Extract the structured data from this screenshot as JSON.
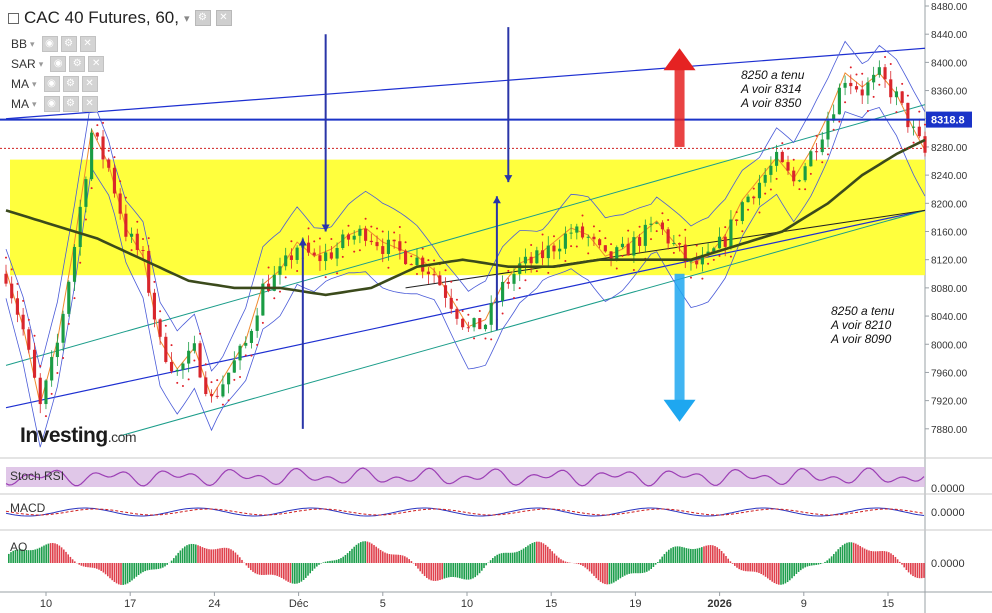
{
  "header": {
    "title": "CAC 40 Futures, 60,",
    "overlays": [
      {
        "name": "BB"
      },
      {
        "name": "SAR"
      },
      {
        "name": "MA"
      },
      {
        "name": "MA"
      }
    ]
  },
  "logo": {
    "name": "Investing",
    "suffix": ".com"
  },
  "notes": {
    "upper": [
      "8250 a tenu",
      "A voir 8314",
      "A voir 8350"
    ],
    "lower": [
      "8250 a tenu",
      "A voir 8210",
      "A voir 8090"
    ]
  },
  "subpanels": [
    {
      "label": "Stoch RSI",
      "value": "0.0000"
    },
    {
      "label": "MACD",
      "value": "0.0000"
    },
    {
      "label": "AO",
      "value": "0.0000"
    }
  ],
  "colors": {
    "zone": "#ffff33",
    "channel": "#1d2fd1",
    "ma_long": "#3b4a1b",
    "up_arrow": "#e52222",
    "down_arrow": "#1ea7f0",
    "price_label_bg": "#1a33c8",
    "rsi_line": "#9c3fb5",
    "ao_up": "#1e9e4c",
    "ao_down": "#e0414d"
  },
  "chart_data": {
    "type": "candlestick",
    "instrument": "CAC 40 Futures",
    "timeframe": "60",
    "ylim": [
      7840,
      8480
    ],
    "y_ticks": [
      8480,
      8440,
      8400,
      8360,
      8320,
      8280,
      8240,
      8200,
      8160,
      8120,
      8080,
      8040,
      8000,
      7960,
      7920,
      7880
    ],
    "x_ticks": [
      "10",
      "17",
      "24",
      "Déc",
      "5",
      "10",
      "15",
      "19",
      "2026",
      "9",
      "15"
    ],
    "last_price": "8318.8",
    "support_zone": [
      8098,
      8262
    ],
    "horizontal_line": 8318.8,
    "price_path": [
      [
        0,
        8100
      ],
      [
        3,
        8020
      ],
      [
        6,
        7910
      ],
      [
        9,
        8000
      ],
      [
        12,
        8140
      ],
      [
        15,
        8300
      ],
      [
        18,
        8250
      ],
      [
        21,
        8160
      ],
      [
        24,
        8120
      ],
      [
        27,
        8000
      ],
      [
        30,
        7960
      ],
      [
        33,
        7990
      ],
      [
        36,
        7920
      ],
      [
        39,
        7960
      ],
      [
        42,
        8000
      ],
      [
        45,
        8080
      ],
      [
        48,
        8100
      ],
      [
        51,
        8140
      ],
      [
        54,
        8120
      ],
      [
        57,
        8130
      ],
      [
        60,
        8150
      ],
      [
        63,
        8160
      ],
      [
        66,
        8140
      ],
      [
        69,
        8130
      ],
      [
        72,
        8120
      ],
      [
        75,
        8100
      ],
      [
        78,
        8060
      ],
      [
        81,
        8020
      ],
      [
        84,
        8030
      ],
      [
        87,
        8080
      ],
      [
        90,
        8110
      ],
      [
        93,
        8120
      ],
      [
        96,
        8140
      ],
      [
        99,
        8160
      ],
      [
        102,
        8150
      ],
      [
        105,
        8120
      ],
      [
        108,
        8130
      ],
      [
        111,
        8150
      ],
      [
        114,
        8170
      ],
      [
        117,
        8140
      ],
      [
        120,
        8110
      ],
      [
        123,
        8120
      ],
      [
        126,
        8150
      ],
      [
        129,
        8200
      ],
      [
        132,
        8230
      ],
      [
        135,
        8260
      ],
      [
        138,
        8230
      ],
      [
        141,
        8270
      ],
      [
        144,
        8320
      ],
      [
        147,
        8380
      ],
      [
        150,
        8360
      ],
      [
        153,
        8380
      ],
      [
        156,
        8350
      ],
      [
        159,
        8300
      ],
      [
        161,
        8270
      ]
    ],
    "ma_long": [
      [
        0,
        8190
      ],
      [
        8,
        8170
      ],
      [
        16,
        8150
      ],
      [
        24,
        8120
      ],
      [
        32,
        8090
      ],
      [
        40,
        8080
      ],
      [
        48,
        8080
      ],
      [
        56,
        8070
      ],
      [
        64,
        8080
      ],
      [
        72,
        8110
      ],
      [
        80,
        8120
      ],
      [
        88,
        8110
      ],
      [
        96,
        8110
      ],
      [
        104,
        8120
      ],
      [
        112,
        8120
      ],
      [
        120,
        8120
      ],
      [
        128,
        8140
      ],
      [
        136,
        8160
      ],
      [
        144,
        8200
      ],
      [
        150,
        8240
      ],
      [
        156,
        8270
      ],
      [
        161,
        8290
      ]
    ],
    "trend_lines": [
      {
        "name": "upper channel",
        "from": [
          0,
          8320
        ],
        "to": [
          161,
          8420
        ]
      },
      {
        "name": "lower channel",
        "from": [
          0,
          7910
        ],
        "to": [
          161,
          8190
        ]
      },
      {
        "name": "mid channel",
        "from": [
          0,
          7970
        ],
        "to": [
          161,
          8340
        ]
      },
      {
        "name": "support",
        "from": [
          20,
          7870
        ],
        "to": [
          161,
          8190
        ]
      },
      {
        "name": "uptrend",
        "from": [
          70,
          8080
        ],
        "to": [
          161,
          8190
        ]
      }
    ],
    "annotation_arrows": [
      {
        "dir": "down",
        "color": "blue",
        "from": [
          56,
          8440
        ],
        "to": [
          56,
          8160
        ]
      },
      {
        "dir": "up",
        "color": "blue",
        "from": [
          52,
          7880
        ],
        "to": [
          52,
          8150
        ]
      },
      {
        "dir": "down",
        "color": "blue",
        "from": [
          88,
          8450
        ],
        "to": [
          88,
          8230
        ]
      },
      {
        "dir": "up",
        "color": "blue",
        "from": [
          86,
          8020
        ],
        "to": [
          86,
          8210
        ]
      },
      {
        "dir": "up",
        "color": "red",
        "from": [
          118,
          8280
        ],
        "to": [
          118,
          8420
        ]
      },
      {
        "dir": "down",
        "color": "cyan",
        "from": [
          118,
          8100
        ],
        "to": [
          118,
          7890
        ]
      }
    ]
  }
}
